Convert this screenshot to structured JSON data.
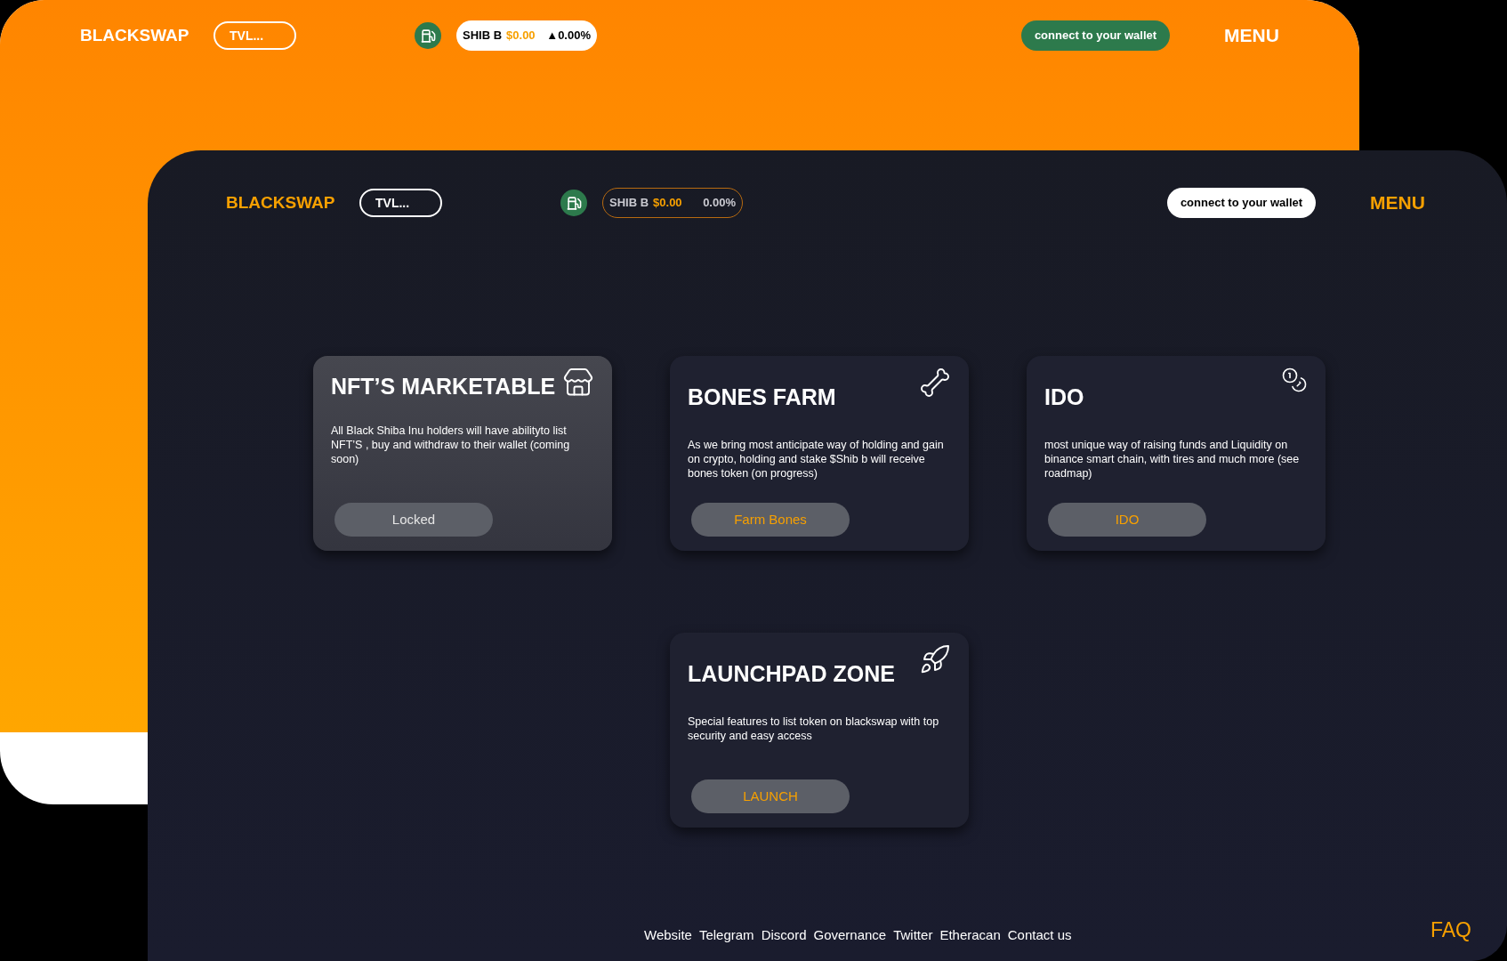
{
  "pages": [
    {
      "kind": "orange",
      "header": {
        "logo": "BLACKSWAP",
        "tvl_button": "TVL...",
        "ticker": {
          "symbol": "SHIB B",
          "price": "$0.00",
          "change": "▲0.00%"
        },
        "wallet_button": "connect to your wallet",
        "menu": "MENU"
      }
    },
    {
      "kind": "dark",
      "header": {
        "logo": "BLACKSWAP",
        "tvl_button": "TVL...",
        "ticker": {
          "symbol": "SHIB B",
          "price": "$0.00",
          "change": "0.00%"
        },
        "wallet_button": "connect to your wallet",
        "menu": "MENU"
      },
      "cards": [
        {
          "kind": "store",
          "selected": true,
          "title": "NFT’S MARKETABLE",
          "description": "All Black Shiba Inu holders will have abilityto list NFT’S , buy and withdraw to their wallet (coming soon)",
          "button": {
            "label": "Locked",
            "locked": true
          }
        },
        {
          "kind": "bone",
          "selected": false,
          "title": "BONES FARM",
          "description": "As we bring most anticipate way of holding and gain on crypto, holding and stake $Shib b will  receive bones token (on progress)",
          "button": {
            "label": "Farm Bones",
            "locked": false
          }
        },
        {
          "kind": "coins",
          "selected": false,
          "title": "IDO",
          "description": "most unique way of raising funds and Liquidity on binance smart chain, with tires and much more (see roadmap)",
          "button": {
            "label": "IDO",
            "locked": false
          }
        },
        {
          "kind": "rocket",
          "selected": false,
          "title": "LAUNCHPAD ZONE",
          "description": "Special features to list token on blackswap with top security and easy access",
          "button": {
            "label": "LAUNCH",
            "locked": false
          }
        }
      ],
      "footer": {
        "links": [
          "Website",
          "Telegram",
          "Discord",
          "Governance",
          "Twitter",
          "Etheracan",
          "Contact us"
        ],
        "faq": "FAQ"
      }
    }
  ]
}
